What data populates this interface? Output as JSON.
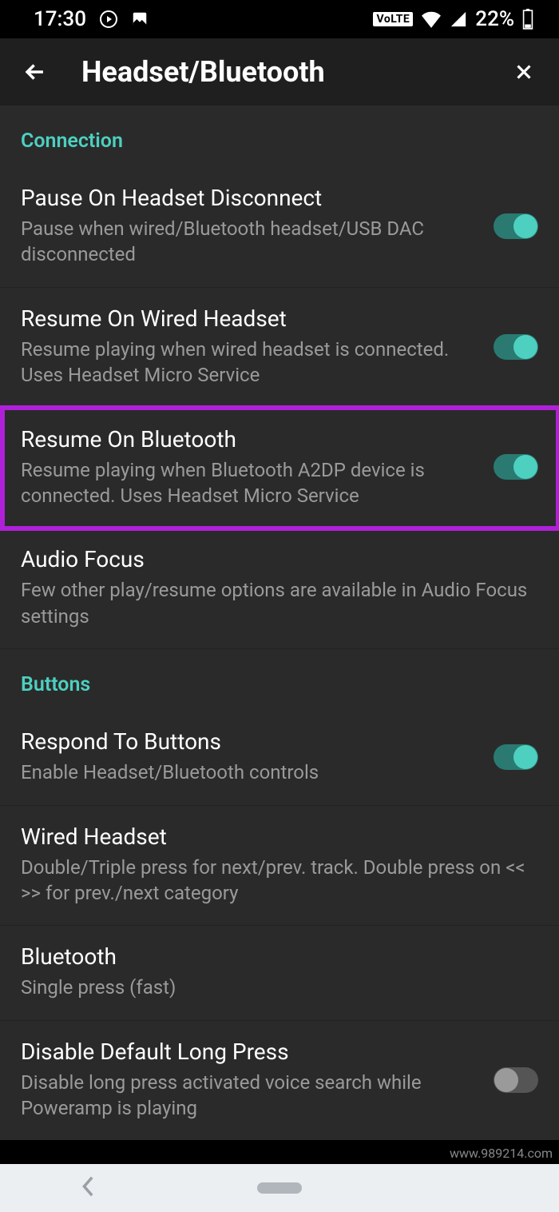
{
  "status": {
    "time": "17:30",
    "volte": "VoLTE",
    "battery": "22%"
  },
  "header": {
    "title": "Headset/Bluetooth"
  },
  "sections": {
    "connection": {
      "label": "Connection",
      "pause_disconnect": {
        "title": "Pause On Headset Disconnect",
        "desc": "Pause when wired/Bluetooth headset/USB DAC disconnected"
      },
      "resume_wired": {
        "title": "Resume On Wired Headset",
        "desc": "Resume playing when wired headset is connected. Uses Headset Micro Service"
      },
      "resume_bt": {
        "title": "Resume On Bluetooth",
        "desc": "Resume playing when Bluetooth A2DP device is connected. Uses Headset Micro Service"
      },
      "audio_focus": {
        "title": "Audio Focus",
        "desc": "Few other play/resume options are available in Audio Focus settings"
      }
    },
    "buttons": {
      "label": "Buttons",
      "respond": {
        "title": "Respond To Buttons",
        "desc": "Enable Headset/Bluetooth controls"
      },
      "wired": {
        "title": "Wired Headset",
        "desc": "Double/Triple press for next/prev. track. Double press on << >> for prev./next category"
      },
      "bluetooth": {
        "title": "Bluetooth",
        "desc": "Single press (fast)"
      },
      "disable_long": {
        "title": "Disable Default Long Press",
        "desc": "Disable long press activated voice search while Poweramp is playing"
      }
    }
  },
  "watermark": "www.989214.com"
}
